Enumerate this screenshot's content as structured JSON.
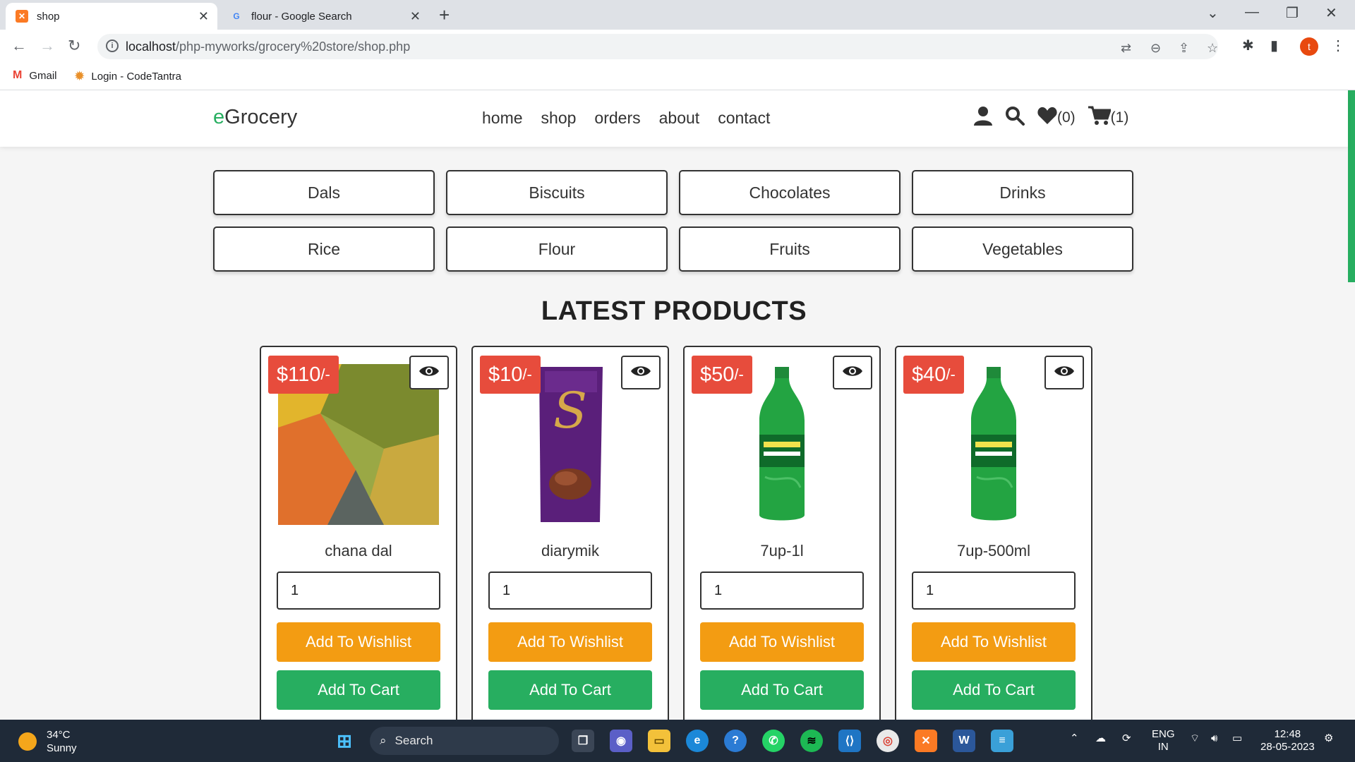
{
  "browser": {
    "tabs": [
      {
        "title": "shop",
        "active": true
      },
      {
        "title": "flour - Google Search",
        "active": false
      }
    ],
    "url_host": "localhost",
    "url_path": "/php-myworks/grocery%20store/shop.php",
    "profile_initial": "t",
    "bookmarks": [
      "Gmail",
      "Login - CodeTantra"
    ]
  },
  "header": {
    "logo_prefix": "e",
    "logo_rest": "Grocery",
    "nav": [
      "home",
      "shop",
      "orders",
      "about",
      "contact"
    ],
    "wishlist_count": "(0)",
    "cart_count": "(1)"
  },
  "categories": [
    "Dals",
    "Biscuits",
    "Chocolates",
    "Drinks",
    "Rice",
    "Flour",
    "Fruits",
    "Vegetables"
  ],
  "section_title": "LATEST PRODUCTS",
  "products": [
    {
      "price": "$110",
      "suffix": "/-",
      "name": "chana dal",
      "qty": "1",
      "wishlist_label": "Add To Wishlist",
      "cart_label": "Add To Cart"
    },
    {
      "price": "$10",
      "suffix": "/-",
      "name": "diarymik",
      "qty": "1",
      "wishlist_label": "Add To Wishlist",
      "cart_label": "Add To Cart"
    },
    {
      "price": "$50",
      "suffix": "/-",
      "name": "7up-1l",
      "qty": "1",
      "wishlist_label": "Add To Wishlist",
      "cart_label": "Add To Cart"
    },
    {
      "price": "$40",
      "suffix": "/-",
      "name": "7up-500ml",
      "qty": "1",
      "wishlist_label": "Add To Wishlist",
      "cart_label": "Add To Cart"
    }
  ],
  "taskbar": {
    "temp": "34°C",
    "condition": "Sunny",
    "search_label": "Search",
    "lang_top": "ENG",
    "lang_bottom": "IN",
    "time": "12:48",
    "date": "28-05-2023"
  },
  "colors": {
    "brand": "#27ae60",
    "price_badge": "#e74c3c",
    "wishlist": "#f39c12",
    "cart": "#27ae60"
  }
}
